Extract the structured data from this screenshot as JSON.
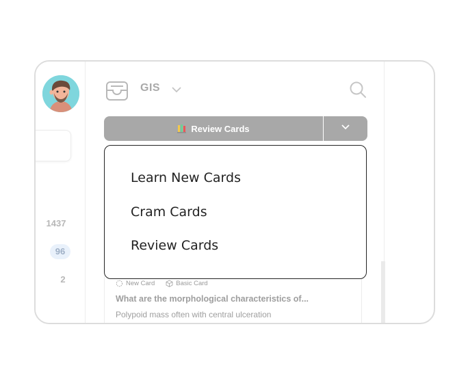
{
  "rail": {
    "counts": [
      "1437",
      "96",
      "2"
    ]
  },
  "header": {
    "deck_name": "GIS",
    "icons": {
      "deck": "inbox-tray-icon",
      "expand": "chevron-down-icon",
      "search": "search-icon"
    }
  },
  "review_button": {
    "label": "Review Cards",
    "emoji_icon": "books-icon",
    "caret_icon": "chevron-down-icon",
    "color": "#a8a8a8"
  },
  "dropdown": {
    "items": [
      "Learn New Cards",
      "Cram Cards",
      "Review Cards"
    ]
  },
  "card": {
    "status": "New Card",
    "type": "Basic Card",
    "question": "What are the morphological characteristics of...",
    "answer": "Polypoid mass often with central ulceration"
  }
}
